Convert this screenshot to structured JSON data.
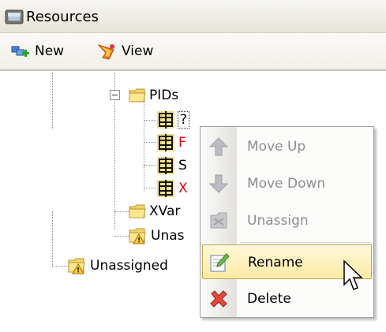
{
  "window": {
    "title": "Resources",
    "icon": "resources-icon"
  },
  "toolbar": {
    "new_label": "New",
    "new_icon": "new-resource-icon",
    "view_label": "View",
    "view_icon": "view-icon"
  },
  "tree": {
    "nodes": [
      {
        "label": "PIDs",
        "icon": "folder-icon",
        "expanded": true
      },
      {
        "label": "?",
        "icon": "pid-icon",
        "selected": true
      },
      {
        "label": "F",
        "icon": "pid-icon",
        "color": "#e00000"
      },
      {
        "label": "S",
        "icon": "pid-icon"
      },
      {
        "label": "X",
        "icon": "pid-icon",
        "color": "#e00000"
      },
      {
        "label": "XVar",
        "icon": "folder-icon"
      },
      {
        "label": "Unas",
        "icon": "warning-folder-icon"
      },
      {
        "label": "Unassigned",
        "icon": "warning-folder-icon"
      }
    ]
  },
  "context_menu": {
    "items": [
      {
        "label": "Move Up",
        "icon": "arrow-up-icon",
        "enabled": false
      },
      {
        "label": "Move Down",
        "icon": "arrow-down-icon",
        "enabled": false
      },
      {
        "label": "Unassign",
        "icon": "unassign-icon",
        "enabled": false
      },
      {
        "label": "Rename",
        "icon": "rename-icon",
        "enabled": true,
        "highlighted": true
      },
      {
        "label": "Delete",
        "icon": "delete-icon",
        "enabled": true
      }
    ]
  }
}
